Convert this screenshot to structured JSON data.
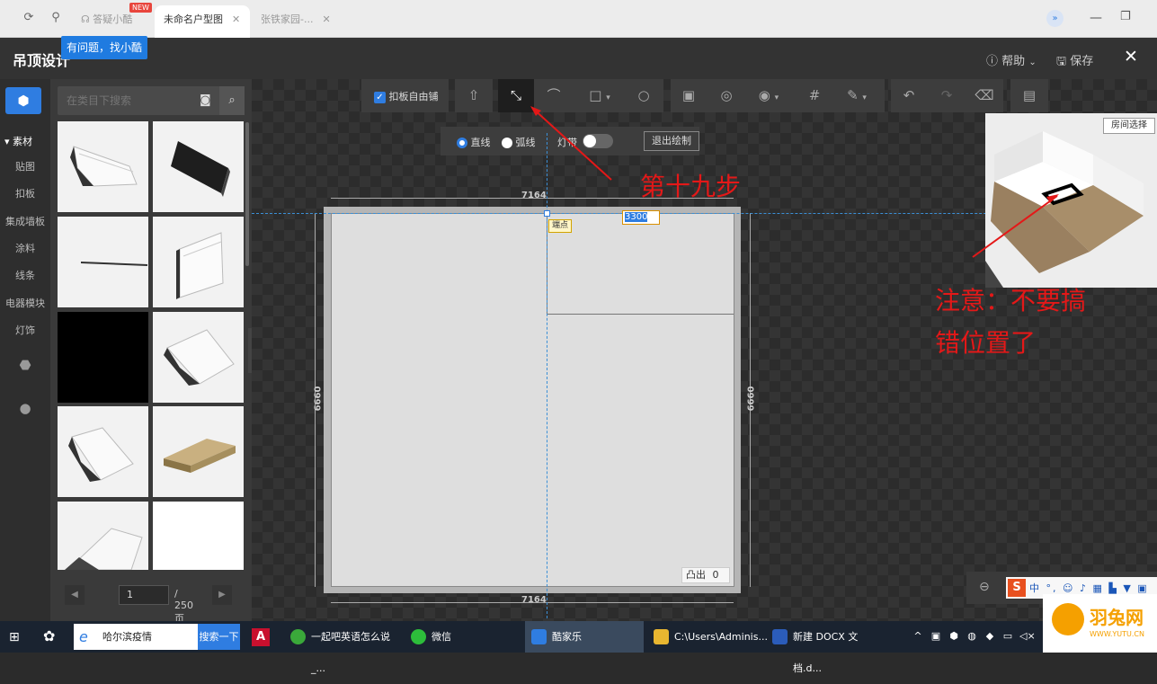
{
  "tabbar": {
    "help_tab": "答疑小酷",
    "new_badge": "NEW",
    "tabs": [
      {
        "label": "未命名户型图",
        "active": true
      },
      {
        "label": "张铁家园-...",
        "active": false
      }
    ],
    "tooltip": "有问题，找小酷"
  },
  "header": {
    "title": "吊顶设计",
    "help": "帮助",
    "save": "保存"
  },
  "rail": {
    "section": "素材",
    "items": [
      "贴图",
      "扣板",
      "集成墙板",
      "涂料",
      "线条",
      "电器模块",
      "灯饰"
    ]
  },
  "panel": {
    "search_placeholder": "在类目下搜索",
    "thumbs": [
      "crown-molding",
      "black-panel",
      "thin-strip",
      "skirting-board",
      "black-tile",
      "crown-molding-2",
      "crown-molding-3",
      "wood-plank",
      "cornice-profile",
      "white-tile"
    ],
    "page_current": "1",
    "page_total": "/ 250 页"
  },
  "toolbar": {
    "free_layout": "扣板自由铺",
    "accent": "#2f7de1"
  },
  "subbar": {
    "line": "直线",
    "arc": "弧线",
    "light_strip": "灯带",
    "exit": "退出绘制"
  },
  "canvas": {
    "dim_top": "7164",
    "dim_bottom": "7164",
    "dim_left": "6660",
    "dim_right": "6660",
    "vertex_tag": "端点",
    "length_input": "3300",
    "convex_label": "凸出",
    "convex_value": "0",
    "room_select": "房间选择"
  },
  "annotations": {
    "step": "第十九步",
    "note_line1": "注意：不要搞",
    "note_line2": "错位置了",
    "color": "#e41818"
  },
  "taskbar": {
    "search_text": "哈尔滨疫情",
    "search_btn": "搜索一下",
    "tasks": [
      {
        "label": "一起吧英语怎么说_...",
        "color": "#3aa83a"
      },
      {
        "label": "微信",
        "color": "#2dbd3b"
      },
      {
        "label": "酷家乐",
        "color": "#2f7de1"
      },
      {
        "label": "C:\\Users\\Adminis...",
        "color": "#e8b630"
      },
      {
        "label": "新建 DOCX 文档.d...",
        "color": "#2b5cba"
      }
    ]
  },
  "watermark": {
    "brand": "羽兔网",
    "url": "WWW.YUTU.CN"
  }
}
